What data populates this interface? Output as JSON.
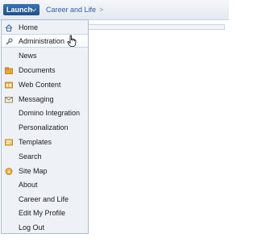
{
  "header": {
    "launch_label": "Launch",
    "breadcrumb": "Career and Life",
    "separator": ">"
  },
  "menu": {
    "items": [
      {
        "label": "Home",
        "icon": "home-icon"
      },
      {
        "label": "Administration",
        "icon": "wrench-icon"
      },
      {
        "label": "News",
        "icon": ""
      },
      {
        "label": "Documents",
        "icon": "documents-icon"
      },
      {
        "label": "Web Content",
        "icon": "web-content-icon"
      },
      {
        "label": "Messaging",
        "icon": "envelope-icon"
      },
      {
        "label": "Domino Integration",
        "icon": ""
      },
      {
        "label": "Personalization",
        "icon": ""
      },
      {
        "label": "Templates",
        "icon": "templates-icon"
      },
      {
        "label": "Search",
        "icon": ""
      },
      {
        "label": "Site Map",
        "icon": "compass-icon"
      },
      {
        "label": "About",
        "icon": ""
      },
      {
        "label": "Career and Life",
        "icon": ""
      },
      {
        "label": "Edit My Profile",
        "icon": ""
      },
      {
        "label": "Log Out",
        "icon": ""
      }
    ]
  },
  "colors": {
    "launch_bg": "#2a5f9e",
    "link": "#2a5da8",
    "menu_bg": "#eef2f7"
  }
}
